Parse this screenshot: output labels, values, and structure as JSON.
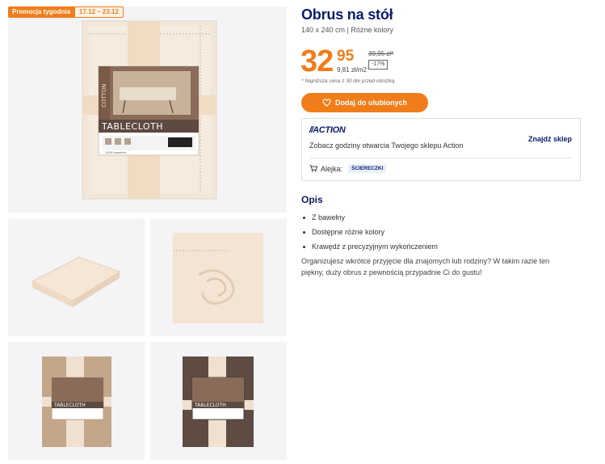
{
  "promo": {
    "label": "Promocja tygodnia",
    "dates": "17.12 – 23.12"
  },
  "gallery": {
    "main": {
      "package_side_text": "COTTON",
      "package_title": "TABLECLOTH",
      "package_bottom": "100% bawełna"
    },
    "thumb3": {
      "package_title": "TABLECLOTH"
    },
    "thumb4": {
      "package_title": "TABLECLOTH"
    }
  },
  "product": {
    "title": "Obrus na stół",
    "subtitle": "140 x 240 cm | Różne kolory",
    "price_whole": "32",
    "price_cents": "95",
    "unit_price": "9,81 zł/m2",
    "old_price": "39,95 zł",
    "old_price_asterisk": "*",
    "discount": "-17%",
    "note": "* Najniższa cena z 30 dni przed obniżką",
    "favorite_button": "Dodaj do ulubionych"
  },
  "store": {
    "logo": "ACTION",
    "hours_text": "Zobacz godziny otwarcia Twojego sklepu Action",
    "find_store": "Znajdź sklep",
    "aisle_label": "Alejka:",
    "aisle_value": "ŚCIERECZKI"
  },
  "description": {
    "heading": "Opis",
    "bullets": [
      "Z bawełny",
      "Dostępne różne kolory",
      "Krawędź z precyzyjnym wykończeniem"
    ],
    "text": "Organizujesz wkrótce przyjęcie dla znajomych lub rodziny? W takim razie ten piękny, duży obrus z pewnością przypadnie Ci do gustu!"
  },
  "colors": {
    "accent": "#f07d19",
    "brand": "#0b1b6b"
  }
}
